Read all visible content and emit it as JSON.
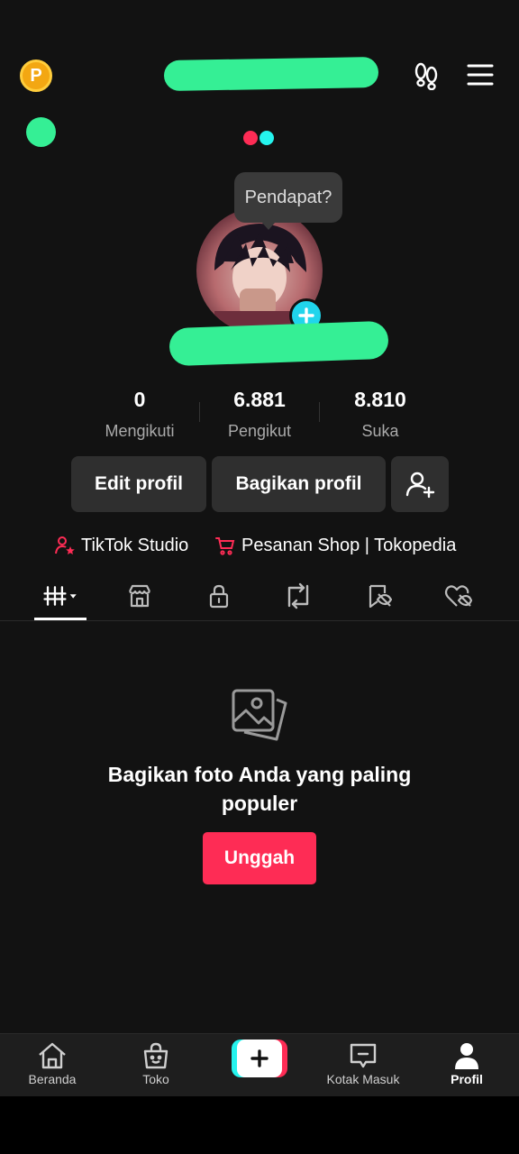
{
  "header": {
    "coin_letter": "P"
  },
  "avatar": {
    "tooltip": "Pendapat?"
  },
  "stats": [
    {
      "value": "0",
      "label": "Mengikuti"
    },
    {
      "value": "6.881",
      "label": "Pengikut"
    },
    {
      "value": "8.810",
      "label": "Suka"
    }
  ],
  "actions": {
    "edit_profile": "Edit profil",
    "share_profile": "Bagikan profil"
  },
  "links": {
    "studio": "TikTok Studio",
    "shop": "Pesanan Shop | Tokopedia"
  },
  "tabs": [
    "videos-grid-icon",
    "shop-icon",
    "lock-icon",
    "repost-icon",
    "favorites-icon",
    "liked-icon"
  ],
  "empty_state": {
    "title": "Bagikan foto Anda yang paling populer",
    "button": "Unggah"
  },
  "bottom_nav": {
    "home": "Beranda",
    "shop": "Toko",
    "inbox": "Kotak Masuk",
    "profile": "Profil"
  },
  "colors": {
    "accent_red": "#fe2c55",
    "accent_cyan": "#25f4ee",
    "redaction_green": "#35ef95",
    "background": "#121212"
  }
}
